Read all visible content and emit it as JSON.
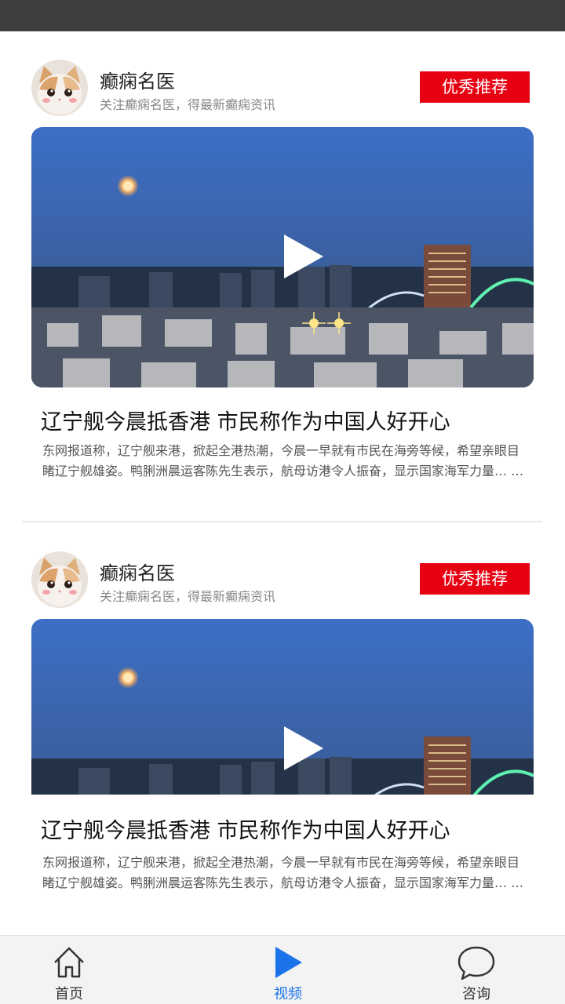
{
  "feed": [
    {
      "author": "癫痫名医",
      "author_desc": "关注癫痫名医，得最新癫痫资讯",
      "badge": "优秀推荐",
      "title": "辽宁舰今晨抵香港 市民称作为中国人好开心",
      "summary": "东网报道称，辽宁舰来港，掀起全港热潮，今晨一早就有市民在海旁等候，希望亲眼目睹辽宁舰雄姿。鸭脷洲晨运客陈先生表示，航母访港令人振奋，显示国家海军力量… …"
    },
    {
      "author": "癫痫名医",
      "author_desc": "关注癫痫名医，得最新癫痫资讯",
      "badge": "优秀推荐",
      "title": "辽宁舰今晨抵香港 市民称作为中国人好开心",
      "summary": "东网报道称，辽宁舰来港，掀起全港热潮，今晨一早就有市民在海旁等候，希望亲眼目睹辽宁舰雄姿。鸭脷洲晨运客陈先生表示，航母访港令人振奋，显示国家海军力量… …"
    }
  ],
  "tabs": [
    {
      "label": "首页",
      "icon": "home-icon",
      "active": false
    },
    {
      "label": "视频",
      "icon": "play-icon",
      "active": true
    },
    {
      "label": "咨询",
      "icon": "chat-bubble-icon",
      "active": false
    }
  ],
  "colors": {
    "status_bar": "#3f3f3f",
    "badge": "#e60012",
    "active_tab": "#1a73e8"
  }
}
